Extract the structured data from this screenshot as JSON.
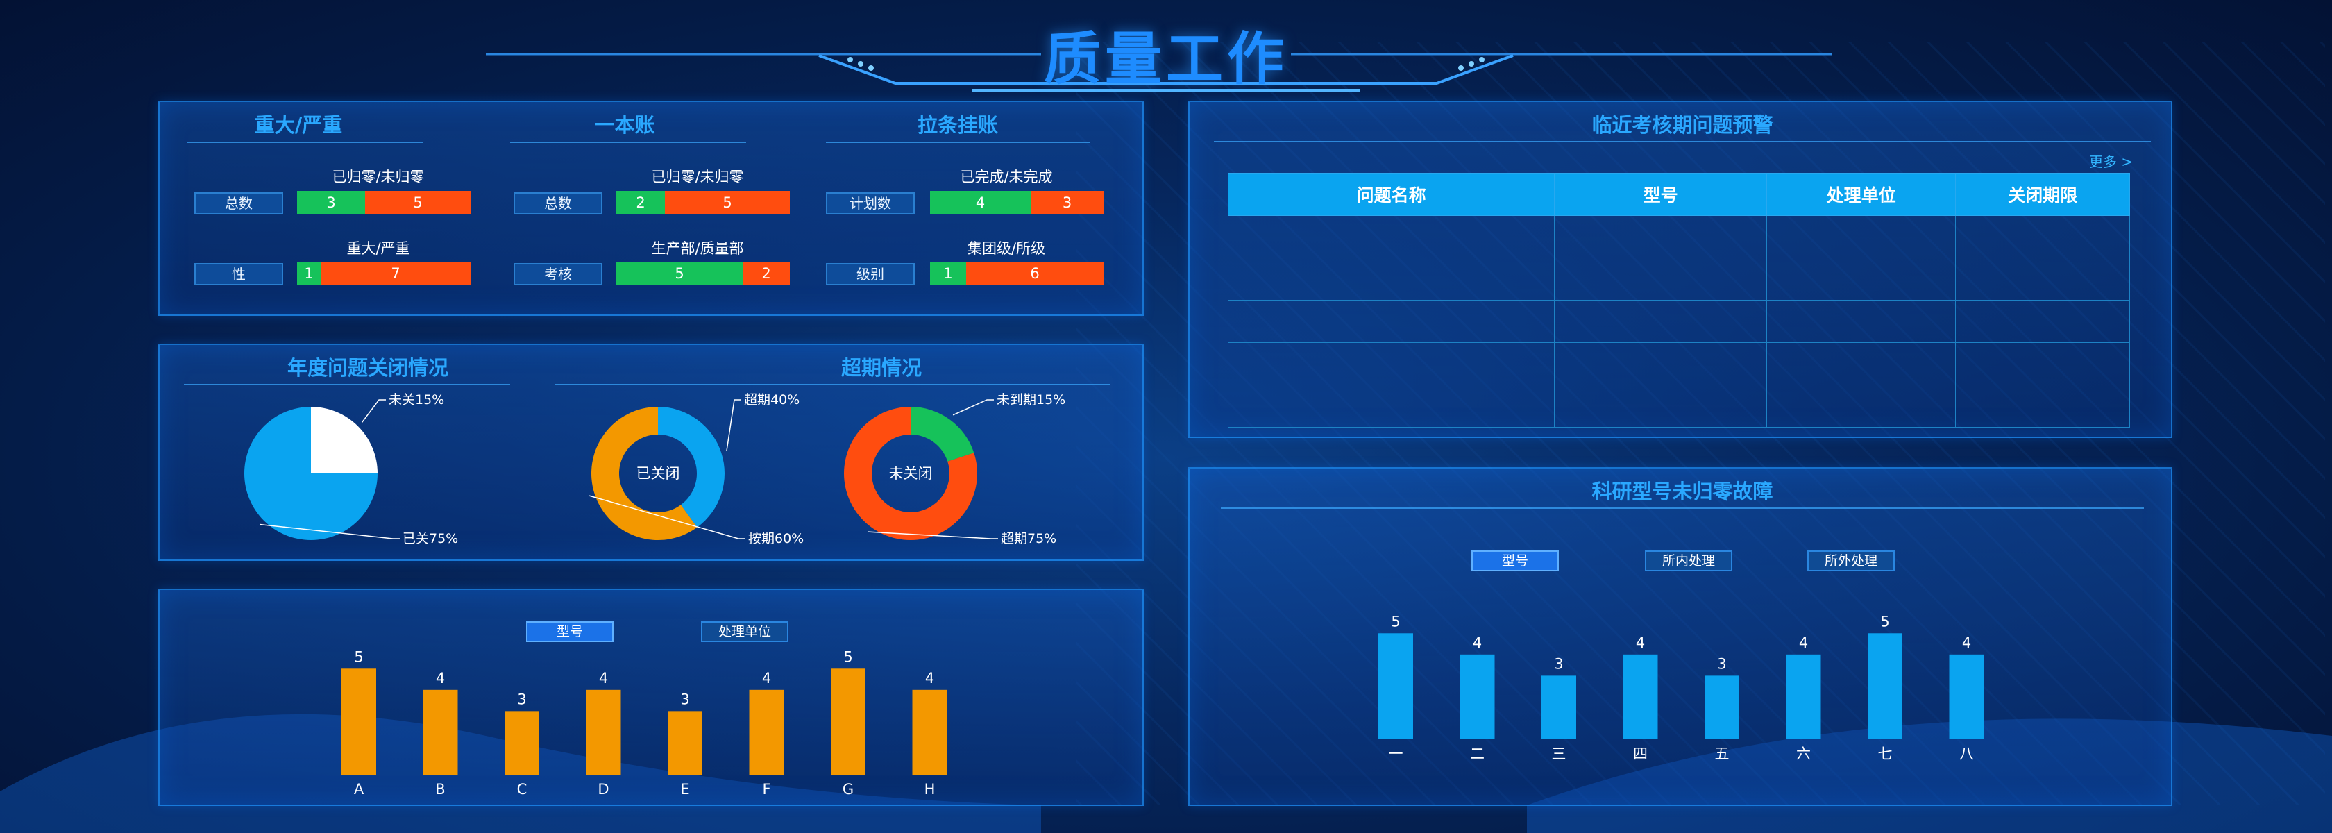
{
  "header": {
    "title": "质量工作"
  },
  "quality_summary": {
    "sections": [
      {
        "title": "重大/严重",
        "rows": [
          {
            "caption": "已归零/未归零",
            "label": "总数",
            "green": 3,
            "red": 5
          },
          {
            "caption": "重大/严重",
            "label": "性",
            "green": 1,
            "red": 7
          }
        ]
      },
      {
        "title": "一本账",
        "rows": [
          {
            "caption": "已归零/未归零",
            "label": "总数",
            "green": 2,
            "red": 5
          },
          {
            "caption": "生产部/质量部",
            "label": "考核",
            "green": 5,
            "red": 2
          }
        ]
      },
      {
        "title": "拉条挂账",
        "rows": [
          {
            "caption": "已完成/未完成",
            "label": "计划数",
            "green": 4,
            "red": 3
          },
          {
            "caption": "集团级/所级",
            "label": "级别",
            "green": 1,
            "red": 6
          }
        ]
      }
    ]
  },
  "annual_closure": {
    "title": "年度问题关闭情况",
    "overdue_title": "超期情况"
  },
  "chart_data": [
    {
      "type": "pie",
      "title": "",
      "slices": [
        {
          "label": "未关15%",
          "value": 25,
          "color": "#ffffff"
        },
        {
          "label": "已关75%",
          "value": 75,
          "color": "#0aa4f0"
        }
      ]
    },
    {
      "type": "pie",
      "title": "已关闭",
      "slices": [
        {
          "label": "超期40%",
          "value": 40,
          "color": "#0aa4f0"
        },
        {
          "label": "按期60%",
          "value": 60,
          "color": "#f39800"
        }
      ]
    },
    {
      "type": "pie",
      "title": "未关闭",
      "slices": [
        {
          "label": "未到期15%",
          "value": 20,
          "color": "#16c25a"
        },
        {
          "label": "超期75%",
          "value": 80,
          "color": "#ff4d0f"
        }
      ]
    },
    {
      "type": "bar",
      "title": "",
      "categories": [
        "A",
        "B",
        "C",
        "D",
        "E",
        "F",
        "G",
        "H"
      ],
      "values": [
        5,
        4,
        3,
        4,
        3,
        4,
        5,
        4
      ],
      "ylim": [
        0,
        5.5
      ],
      "color": "#f39800"
    },
    {
      "type": "bar",
      "title": "",
      "categories": [
        "一",
        "二",
        "三",
        "四",
        "五",
        "六",
        "七",
        "八"
      ],
      "values": [
        5,
        4,
        3,
        4,
        3,
        4,
        5,
        4
      ],
      "ylim": [
        0,
        5.5
      ],
      "color": "#0aa4f0"
    }
  ],
  "bottom_left": {
    "buttons": [
      "型号",
      "处理单位"
    ],
    "active": 0
  },
  "warning": {
    "title": "临近考核期问题预警",
    "more": "更多 >",
    "columns": [
      "问题名称",
      "型号",
      "处理单位",
      "关闭期限"
    ],
    "row_count": 5
  },
  "research": {
    "title": "科研型号未归零故障",
    "buttons": [
      "型号",
      "所内处理",
      "所外处理"
    ],
    "active": 0
  }
}
